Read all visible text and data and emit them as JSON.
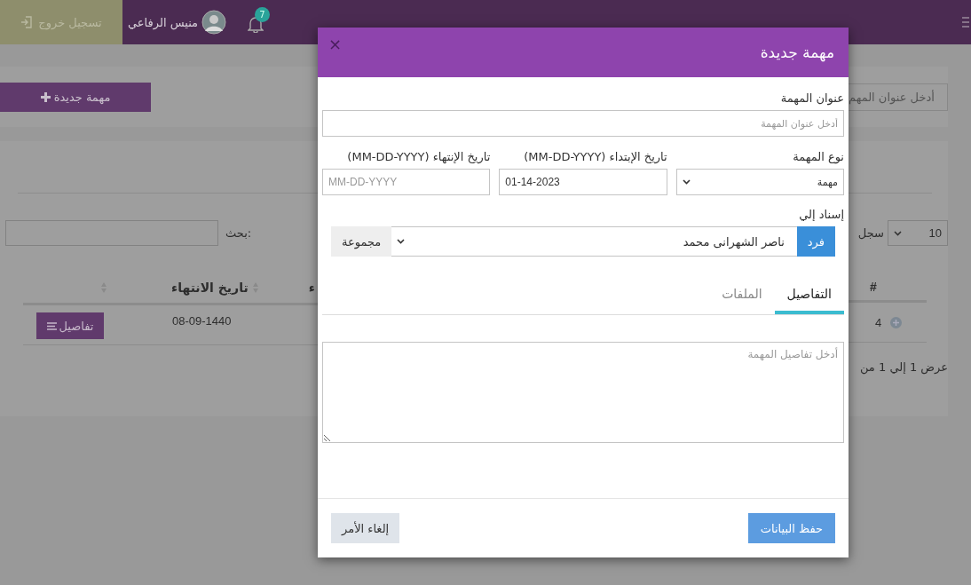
{
  "topbar": {
    "logout": "تسجيل خروج",
    "user_name": "منيس الرفاعي",
    "notifications": "7"
  },
  "toolbar": {
    "new_task_button": "مهمة جديدة",
    "title_filter_placeholder": "أدخل عنوان المهم"
  },
  "table": {
    "page_length": "10",
    "page_length_label": "سجل",
    "search_label": "بحث:",
    "columns": [
      {
        "label": "#"
      },
      {
        "label": "ء"
      },
      {
        "label": "تاريخ الانتهاء"
      }
    ],
    "rows": [
      {
        "number": "4",
        "end_date": "08-09-1440",
        "action": "تفاصيل"
      }
    ],
    "info": "عرض 1 إلي 1 من"
  },
  "modal": {
    "title": "مهمة جديدة",
    "close": "×",
    "title_label": "عنوان المهمة",
    "title_placeholder": "أدخل عنوان المهمة",
    "type_label": "نوع المهمة",
    "type_value": "مهمة",
    "start_label": "تاريخ الإبتداء (MM-DD-YYYY)",
    "start_value": "01-14-2023",
    "end_label": "تاريخ الإنتهاء (MM-DD-YYYY)",
    "end_placeholder": "MM-DD-YYYY",
    "assign_label": "إسناد إلي",
    "assign_options": [
      {
        "label": "فرد",
        "selected": true
      },
      {
        "label": "مجموعة",
        "selected": false
      }
    ],
    "assignee": "ناصر الشهرانى محمد",
    "tabs": [
      {
        "label": "التفاصيل",
        "selected": true
      },
      {
        "label": "الملفات",
        "selected": false
      }
    ],
    "details_placeholder": "أدخل تفاصيل المهمة",
    "save_button": "حفظ البيانات",
    "cancel_button": "إلغاء الأمر"
  }
}
